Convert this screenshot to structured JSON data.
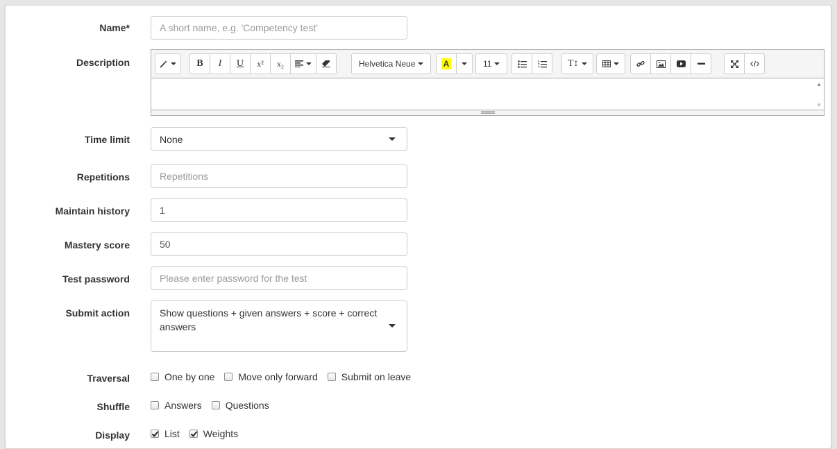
{
  "form": {
    "name": {
      "label": "Name*",
      "placeholder": "A short name, e.g. 'Competency test'"
    },
    "description": {
      "label": "Description",
      "toolbar": {
        "font_family": "Helvetica Neue",
        "font_size": "11",
        "highlight_letter": "A",
        "superscript": "x²",
        "subscript": "x₂",
        "bold": "B",
        "italic": "I",
        "underline": "U",
        "text_size_glyph": "T↕"
      }
    },
    "time_limit": {
      "label": "Time limit",
      "value": "None"
    },
    "repetitions": {
      "label": "Repetitions",
      "placeholder": "Repetitions"
    },
    "maintain_history": {
      "label": "Maintain history",
      "value": "1"
    },
    "mastery_score": {
      "label": "Mastery score",
      "value": "50"
    },
    "test_password": {
      "label": "Test password",
      "placeholder": "Please enter password for the test"
    },
    "submit_action": {
      "label": "Submit action",
      "value": "Show questions + given answers + score + correct answers"
    },
    "traversal": {
      "label": "Traversal",
      "options": [
        {
          "label": "One by one",
          "checked": false
        },
        {
          "label": "Move only forward",
          "checked": false
        },
        {
          "label": "Submit on leave",
          "checked": false
        }
      ]
    },
    "shuffle": {
      "label": "Shuffle",
      "options": [
        {
          "label": "Answers",
          "checked": false
        },
        {
          "label": "Questions",
          "checked": false
        }
      ]
    },
    "display": {
      "label": "Display",
      "options": [
        {
          "label": "List",
          "checked": true
        },
        {
          "label": "Weights",
          "checked": true
        }
      ]
    }
  },
  "colors": {
    "highlight": "#ffff00",
    "border": "#cccccc"
  }
}
